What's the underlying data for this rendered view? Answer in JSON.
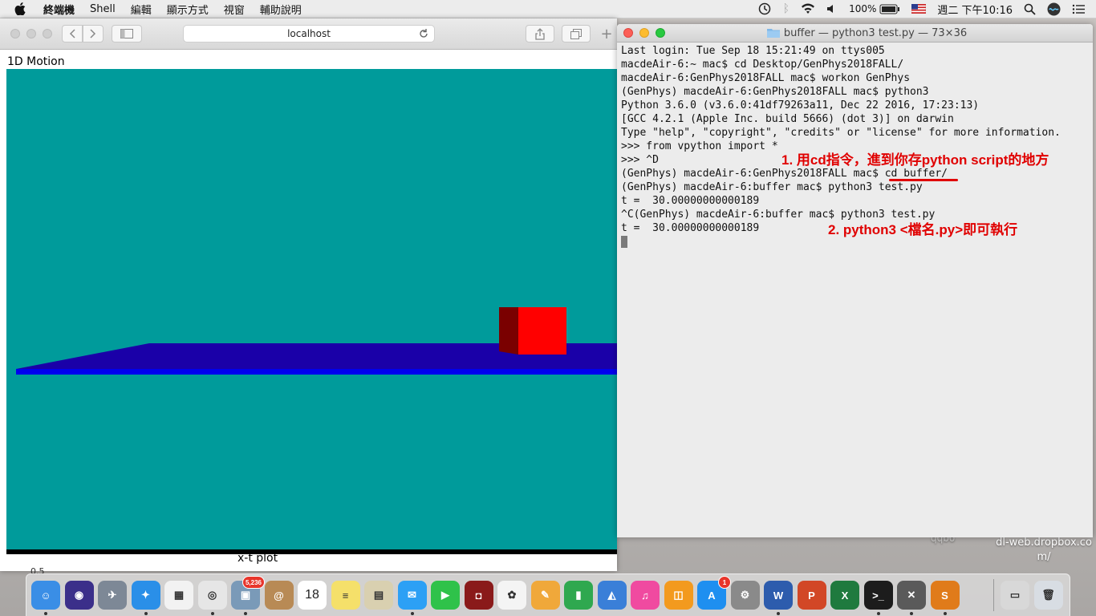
{
  "menubar": {
    "items": [
      "終端機",
      "Shell",
      "編輯",
      "顯示方式",
      "視窗",
      "輔助說明"
    ],
    "battery": "100%",
    "clock": "週二 下午10:16"
  },
  "browser": {
    "address": "localhost",
    "heading": "1D Motion",
    "plot_title": "x-t plot",
    "plot_tick": "0.5",
    "scene": {
      "background": "#009b9b",
      "floor_color": "#1a00a8",
      "floor_edge_color": "#0000ee",
      "box_front_color": "#ff0000",
      "box_side_color": "#7a0000"
    }
  },
  "terminal": {
    "title": "buffer — python3 test.py — 73×36",
    "lines": [
      "Last login: Tue Sep 18 15:21:49 on ttys005",
      "macdeAir-6:~ mac$ cd Desktop/GenPhys2018FALL/",
      "macdeAir-6:GenPhys2018FALL mac$ workon GenPhys",
      "(GenPhys) macdeAir-6:GenPhys2018FALL mac$ python3",
      "Python 3.6.0 (v3.6.0:41df79263a11, Dec 22 2016, 17:23:13)",
      "[GCC 4.2.1 (Apple Inc. build 5666) (dot 3)] on darwin",
      "Type \"help\", \"copyright\", \"credits\" or \"license\" for more information.",
      ">>> from vpython import *",
      ">>> ^D",
      "(GenPhys) macdeAir-6:GenPhys2018FALL mac$ cd buffer/",
      "(GenPhys) macdeAir-6:buffer mac$ python3 test.py",
      "t =  30.00000000000189",
      "^C(GenPhys) macdeAir-6:buffer mac$ python3 test.py",
      "t =  30.00000000000189"
    ],
    "annotation_1": "1. 用cd指令，進到你存python script的地方",
    "annotation_2": "2. python3 <檔名.py>即可執行",
    "annotation_color": "#e00000"
  },
  "desktop": {
    "partial_label": "qqbo",
    "file_label": "dl-web.dropbox.com/"
  },
  "dock": {
    "items": [
      {
        "name": "finder-icon",
        "color": "#3a8ee6",
        "glyph": "☺"
      },
      {
        "name": "siri-icon",
        "color": "#3b2f8a",
        "glyph": "◉"
      },
      {
        "name": "launchpad-icon",
        "color": "#7d8896",
        "glyph": "✈"
      },
      {
        "name": "safari-icon",
        "color": "#2a8fe8",
        "glyph": "✦"
      },
      {
        "name": "app-grid-icon",
        "color": "#f2f2f2",
        "glyph": "▦"
      },
      {
        "name": "chrome-icon",
        "color": "#e6e6e6",
        "glyph": "◎"
      },
      {
        "name": "photo-utility-icon",
        "color": "#7a9ab8",
        "glyph": "▣"
      },
      {
        "name": "contacts-icon",
        "color": "#b88a55",
        "glyph": "@"
      },
      {
        "name": "calendar-icon",
        "color": "#ffffff",
        "glyph": "18"
      },
      {
        "name": "notes-icon",
        "color": "#f5e06a",
        "glyph": "≡"
      },
      {
        "name": "preview-icon",
        "color": "#d9d0b0",
        "glyph": "▤"
      },
      {
        "name": "messages-icon",
        "color": "#2ca0f5",
        "glyph": "✉"
      },
      {
        "name": "facetime-icon",
        "color": "#2fc24a",
        "glyph": "▶"
      },
      {
        "name": "photo-booth-icon",
        "color": "#8a1a1a",
        "glyph": "◘"
      },
      {
        "name": "photos-icon",
        "color": "#f4f4f4",
        "glyph": "✿"
      },
      {
        "name": "notebook-icon",
        "color": "#f0a83a",
        "glyph": "✎"
      },
      {
        "name": "numbers-icon",
        "color": "#2fa84f",
        "glyph": "▮"
      },
      {
        "name": "keynote-icon",
        "color": "#3a7fd8",
        "glyph": "◭"
      },
      {
        "name": "itunes-icon",
        "color": "#f04aa0",
        "glyph": "♫"
      },
      {
        "name": "ibooks-icon",
        "color": "#f39a1e",
        "glyph": "◫"
      },
      {
        "name": "app-store-icon",
        "color": "#1e8ff0",
        "glyph": "A"
      },
      {
        "name": "system-preferences-icon",
        "color": "#8a8a8a",
        "glyph": "⚙"
      },
      {
        "name": "word-icon",
        "color": "#2d5cad",
        "glyph": "W"
      },
      {
        "name": "powerpoint-icon",
        "color": "#d24726",
        "glyph": "P"
      },
      {
        "name": "excel-icon",
        "color": "#1f7a3e",
        "glyph": "X"
      },
      {
        "name": "terminal-icon",
        "color": "#1c1c1c",
        "glyph": ">_"
      },
      {
        "name": "x11-icon",
        "color": "#5a5a5a",
        "glyph": "✕"
      },
      {
        "name": "sublime-text-icon",
        "color": "#e07b1a",
        "glyph": "S"
      },
      {
        "name": "documents-folder-icon",
        "color": "#d8d8d8",
        "glyph": "▭"
      },
      {
        "name": "trash-icon",
        "color": "#d8dde3",
        "glyph": "🗑"
      }
    ],
    "badges": {
      "photo_utility": "5,236",
      "app_store": "1"
    },
    "calendar_date": "18"
  }
}
